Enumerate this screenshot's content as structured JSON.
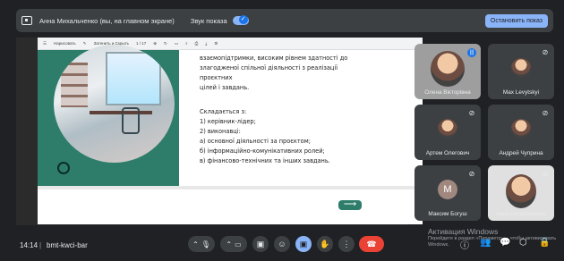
{
  "topbar": {
    "presenter_text": "Анна Михальченко (вы, на главном экране)",
    "sound_label": "Звук показа",
    "stop_label": "Остановить показ"
  },
  "doc_toolbar": {
    "items": [
      "Нарисовать",
      "Затенить и Скрыть",
      "1 / 17"
    ]
  },
  "slide": {
    "line1": "взаємопідтримки, високим рівнем здатності до",
    "line2": "злагодженої спільної діяльності з реалізації проєктних",
    "line3": "цілей і завдань.",
    "heading": "Складається з:",
    "item1": "1) керівник-лідер;",
    "item2": "2) виконавці:",
    "item3": "а) основної діяльності за проєктом;",
    "item4": "б) інформаційно-комунікативних ролей;",
    "item5": "в) фінансово-технічних та інших завдань.",
    "next_arrow": "⟶"
  },
  "participants": [
    {
      "name": "Олена Вікторівна"
    },
    {
      "name": "Max Levytskyi"
    },
    {
      "name": "Артем Олегович"
    },
    {
      "name": "Андрей Чуприна"
    },
    {
      "name": "Максим Богуш",
      "initial": "М"
    },
    {
      "name": "Анна Михальченко"
    }
  ],
  "bottom": {
    "time": "14:14",
    "separator": "|",
    "meeting_code": "bmt-kwci-bar"
  },
  "watermark": {
    "title": "Активация Windows",
    "subtitle": "Перейдите в раздел «Параметры», чтобы активировать Windows."
  },
  "colors": {
    "background": "#202124",
    "accent": "#8ab4f8",
    "slide_green": "#2e7d6b",
    "end_call": "#ea4335"
  }
}
